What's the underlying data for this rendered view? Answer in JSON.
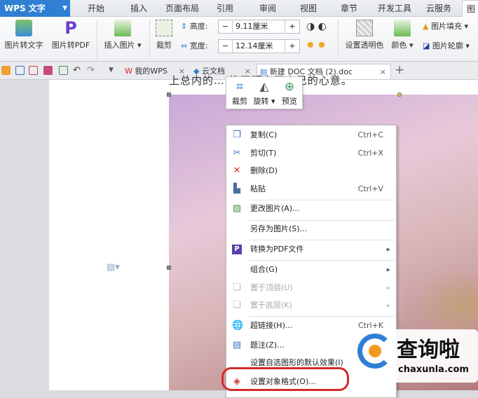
{
  "app": {
    "name": "WPS 文字"
  },
  "menu_tabs": [
    "开始",
    "插入",
    "页面布局",
    "引用",
    "审阅",
    "视图",
    "章节",
    "开发工具",
    "云服务",
    "图"
  ],
  "ribbon": {
    "pic_to_text": "图片转文字",
    "pic_to_pdf": "图片转PDF",
    "insert_picture": "插入图片 ▾",
    "crop": "裁剪",
    "height_label": "高度:",
    "height_value": "9.11厘米",
    "width_label": "宽度:",
    "width_value": "12.14厘米",
    "minus": "−",
    "plus": "+",
    "set_transparent": "设置透明色",
    "color": "颜色 ▾",
    "picture_fill": "图片填充 ▾",
    "picture_outline": "图片轮廓 ▾"
  },
  "doc_tabs": [
    {
      "label": "我的WPS"
    },
    {
      "label": "云文档"
    },
    {
      "label": "新建 DOC 文档 (2).doc"
    }
  ],
  "tab_close": "×",
  "new_tab": "+",
  "document": {
    "text_line": "上总内的…            终于明白了自己的心意。"
  },
  "mini_toolbar": [
    {
      "label": "裁剪",
      "icon": "crop-icon"
    },
    {
      "label": "旋转 ▾",
      "icon": "rotate-icon"
    },
    {
      "label": "预览",
      "icon": "zoom-icon"
    }
  ],
  "context_menu": [
    {
      "label": "复制(C)",
      "shortcut": "Ctrl+C",
      "icon": "copy-icon"
    },
    {
      "label": "剪切(T)",
      "shortcut": "Ctrl+X",
      "icon": "scissors-icon"
    },
    {
      "label": "删除(D)",
      "icon": "delete-icon"
    },
    {
      "label": "粘贴",
      "shortcut": "Ctrl+V",
      "icon": "paste-icon"
    },
    {
      "label": "更改图片(A)...",
      "icon": "change-picture-icon"
    },
    {
      "label": "另存为图片(S)..."
    },
    {
      "label": "转换为PDF文件",
      "icon": "pdf-icon",
      "submenu": true
    },
    {
      "label": "组合(G)",
      "submenu": true
    },
    {
      "label": "置于顶层(U)",
      "icon": "bring-front-icon",
      "submenu": true,
      "disabled": true
    },
    {
      "label": "置于底层(K)",
      "icon": "send-back-icon",
      "submenu": true,
      "disabled": true
    },
    {
      "label": "超链接(H)...",
      "shortcut": "Ctrl+K",
      "icon": "hyperlink-icon"
    },
    {
      "label": "题注(Z)...",
      "icon": "caption-icon"
    },
    {
      "label": "设置自选图形的默认效果(I)"
    },
    {
      "label": "设置对象格式(O)...",
      "icon": "format-object-icon"
    }
  ],
  "watermark": {
    "title": "查询啦",
    "url": "chaxunla.com"
  },
  "colors": {
    "accent": "#2f7fd3",
    "highlight": "#d22b2b"
  }
}
